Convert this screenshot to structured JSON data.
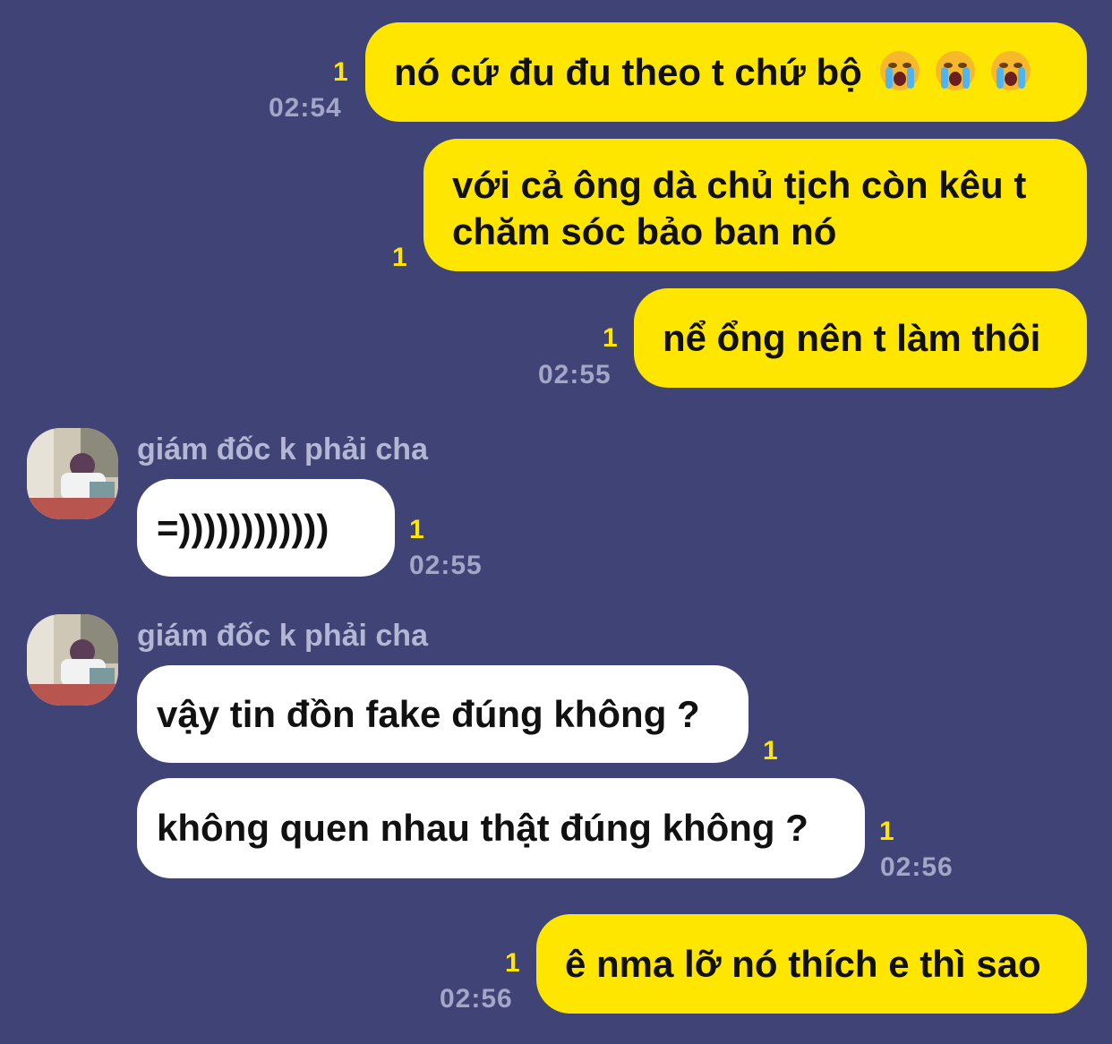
{
  "conversation": {
    "contact_name": "giám đốc k phải cha",
    "messages": [
      {
        "text": "nó cứ đu đu theo t chứ bộ",
        "emojis": [
          "loudly-crying-face",
          "loudly-crying-face",
          "loudly-crying-face"
        ],
        "read": "1",
        "time": "02:54"
      },
      {
        "text": "với cả ông dà chủ tịch còn kêu t chăm sóc bảo ban nó",
        "read": "1"
      },
      {
        "text": "nể ổng nên t làm thôi",
        "read": "1",
        "time": "02:55"
      },
      {
        "sender": "giám đốc k phải cha",
        "text": "=))))))))))))",
        "read": "1",
        "time": "02:55"
      },
      {
        "sender": "giám đốc k phải cha",
        "text": "vậy tin đồn fake đúng không ?",
        "read": "1"
      },
      {
        "text": "không quen nhau thật đúng không ?",
        "read": "1",
        "time": "02:56"
      },
      {
        "text": "ê nma lỡ nó thích e thì sao",
        "read": "1",
        "time": "02:56"
      }
    ]
  },
  "colors": {
    "background": "#3f4375",
    "outgoing_bubble": "#ffe600",
    "incoming_bubble": "#ffffff",
    "read_indicator": "#ffe600",
    "timestamp": "#a3a6c7"
  }
}
